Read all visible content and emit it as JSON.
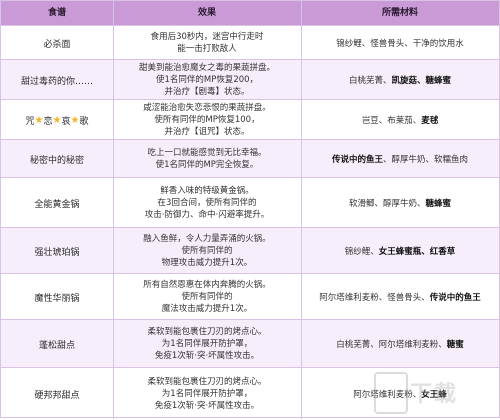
{
  "headers": {
    "recipe": "食谱",
    "effect": "效果",
    "materials": "所需材料"
  },
  "rows": [
    {
      "name": "必杀面",
      "effect": [
        "食用后30秒内，迷宫中行走时",
        "能一击打败敌人"
      ],
      "materials": [
        {
          "t": "锦纱鲤、怪兽骨头、干净的饮用水",
          "b": false
        }
      ]
    },
    {
      "name": "甜过毒药的你……",
      "effect": [
        "甜美到能治愈魔女之毒的果蔬拼盘。",
        "使1名同伴的MP恢复200，",
        "并治疗【剧毒】状态。"
      ],
      "materials": [
        {
          "t": "白桃芜菁、",
          "b": false
        },
        {
          "t": "凯旋菇、糖蜂蜜",
          "b": true
        }
      ]
    },
    {
      "name_parts": [
        "咒",
        "恋",
        "哀",
        "歌"
      ],
      "effect": [
        "咸涩能治愈失恋悲恨的果蔬拼盘。",
        "使所有同伴的MP恢复100，",
        "并治疗【诅咒】状态。"
      ],
      "materials": [
        {
          "t": "岂豆、布莱茄、",
          "b": false
        },
        {
          "t": "麦毬",
          "b": true
        }
      ]
    },
    {
      "name": "秘密中的秘密",
      "effect": [
        "吃上一口就能感觉到无比幸福。",
        "使1名同伴的MP完全恢复。"
      ],
      "materials": [
        {
          "t": "传说中的鱼王",
          "b": true
        },
        {
          "t": "、醇厚牛奶、软糯鱼肉",
          "b": false
        }
      ]
    },
    {
      "name": "全能黄金锅",
      "effect": [
        "鲜香入味的特级黄金锅。",
        "在3回合间，使所有同伴的",
        "攻击·防御力、命中·闪避率提升。"
      ],
      "materials": [
        {
          "t": "软滑鲫、醇厚牛奶、",
          "b": false
        },
        {
          "t": "糖蜂蜜",
          "b": true
        }
      ]
    },
    {
      "name": "强壮琥珀锅",
      "effect": [
        "融入鱼鲜，令人力量弄涌的火锅。",
        "使所有同伴的",
        "物理攻击威力提升1次。"
      ],
      "materials": [
        {
          "t": "锦纱鲤、",
          "b": false
        },
        {
          "t": "女王蜂蜜瓶、红香草",
          "b": true
        }
      ]
    },
    {
      "name": "魔性华丽锅",
      "effect": [
        "所有自然恩惠在体内奔腾的火锅。",
        "使所有同伴的",
        "魔法攻击威力提升1次。"
      ],
      "materials": [
        {
          "t": "阿尔塔维利麦粉、怪兽骨头、",
          "b": false
        },
        {
          "t": "传说中的鱼王",
          "b": true
        }
      ]
    },
    {
      "name": "蓬松甜点",
      "effect": [
        "柔软到能包裹住刀刃的烤点心。",
        "为1名同伴展开防护罩，",
        "免疫1次斩·突·坏属性攻击。"
      ],
      "materials": [
        {
          "t": "白桃芜菁、阿尔塔维利麦粉、",
          "b": false
        },
        {
          "t": "糖蜜",
          "b": true
        }
      ]
    },
    {
      "name": "硬邦邦甜点",
      "effect": [
        "柔软到能包裹住刀刃的烤点心。",
        "为1名同伴展开防护罩，",
        "免疫1次斩·突·坏属性攻击。"
      ],
      "materials": [
        {
          "t": "阿尔塔维利麦粉、",
          "b": false
        },
        {
          "t": "女王蜂",
          "b": true
        }
      ]
    }
  ],
  "watermark": {
    "icon": "site-logo-icon",
    "text": "下载"
  },
  "colors": {
    "header_bg": "#c99ad6",
    "alt_row_bg": "#f6eefa",
    "border": "#d8c3e6",
    "star": "#f3b623"
  }
}
